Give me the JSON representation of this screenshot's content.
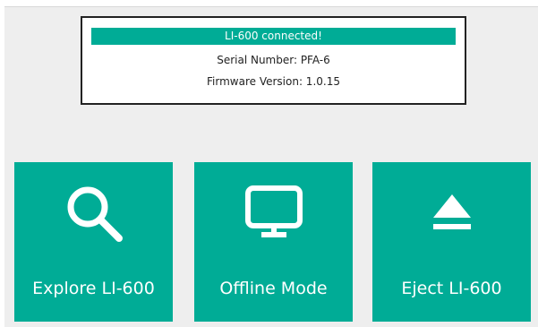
{
  "status": {
    "banner": "LI-600 connected!",
    "serial": "Serial Number: PFA-6",
    "firmware": "Firmware Version: 1.0.15"
  },
  "tiles": [
    {
      "label": "Explore LI-600",
      "icon": "search-icon"
    },
    {
      "label": "Offline Mode",
      "icon": "monitor-icon"
    },
    {
      "label": "Eject LI-600",
      "icon": "eject-icon"
    }
  ],
  "colors": {
    "accent": "#00ac96",
    "background": "#eeeeee",
    "panel_border": "#222222",
    "text": "#222222",
    "tile_text": "#ffffff"
  }
}
